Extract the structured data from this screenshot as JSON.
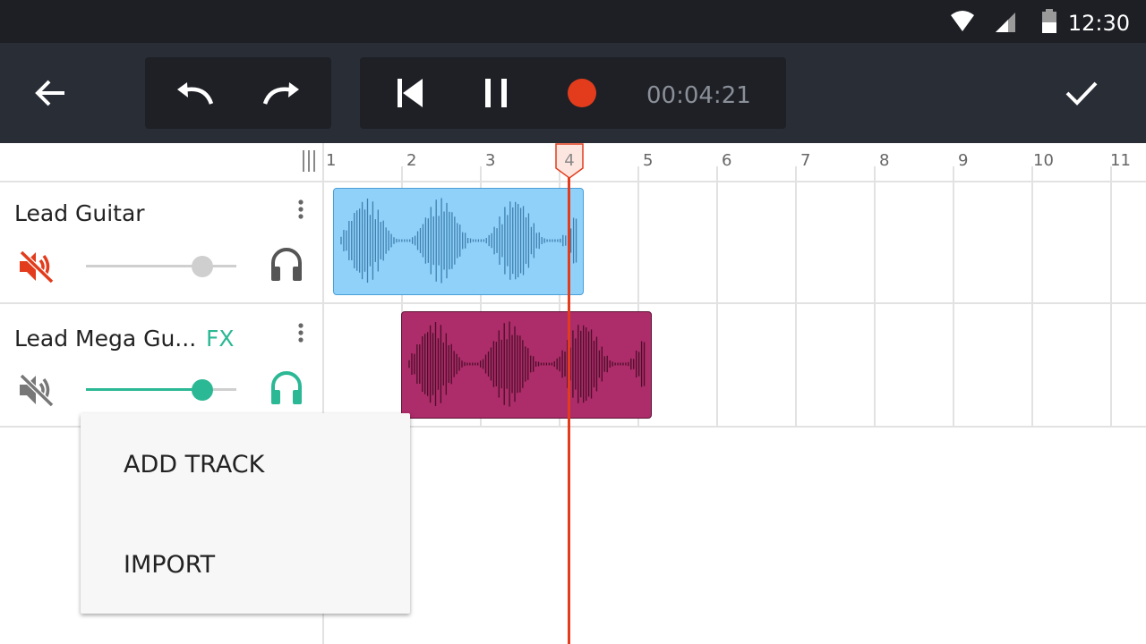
{
  "status_bar": {
    "time": "12:30",
    "icons": [
      "wifi-icon",
      "cell-signal-icon",
      "battery-icon"
    ]
  },
  "toolbar": {
    "icons": [
      "back-arrow-icon",
      "undo-icon",
      "redo-icon",
      "skip-to-start-icon",
      "pause-icon",
      "record-icon",
      "check-icon"
    ],
    "timecode": "00:04:21"
  },
  "ruler": {
    "ticks": [
      "1",
      "2",
      "3",
      "4",
      "5",
      "6",
      "7",
      "8",
      "9",
      "10",
      "11"
    ],
    "playhead_position": "4"
  },
  "tracks": [
    {
      "name": "Lead Guitar",
      "fx": "",
      "muted": true,
      "solo": false,
      "volume": 0.77,
      "clip_color": "#90d1fa"
    },
    {
      "name": "Lead Mega Gu...",
      "fx": "FX",
      "muted": false,
      "solo": true,
      "volume": 0.77,
      "clip_color": "#ad2c6a"
    }
  ],
  "menu": {
    "items": [
      "ADD TRACK",
      "IMPORT"
    ]
  },
  "colors": {
    "accent": "#2bb894",
    "record": "#e23c1c",
    "toolbar": "#292d36",
    "mute_active": "#e23c1c"
  }
}
